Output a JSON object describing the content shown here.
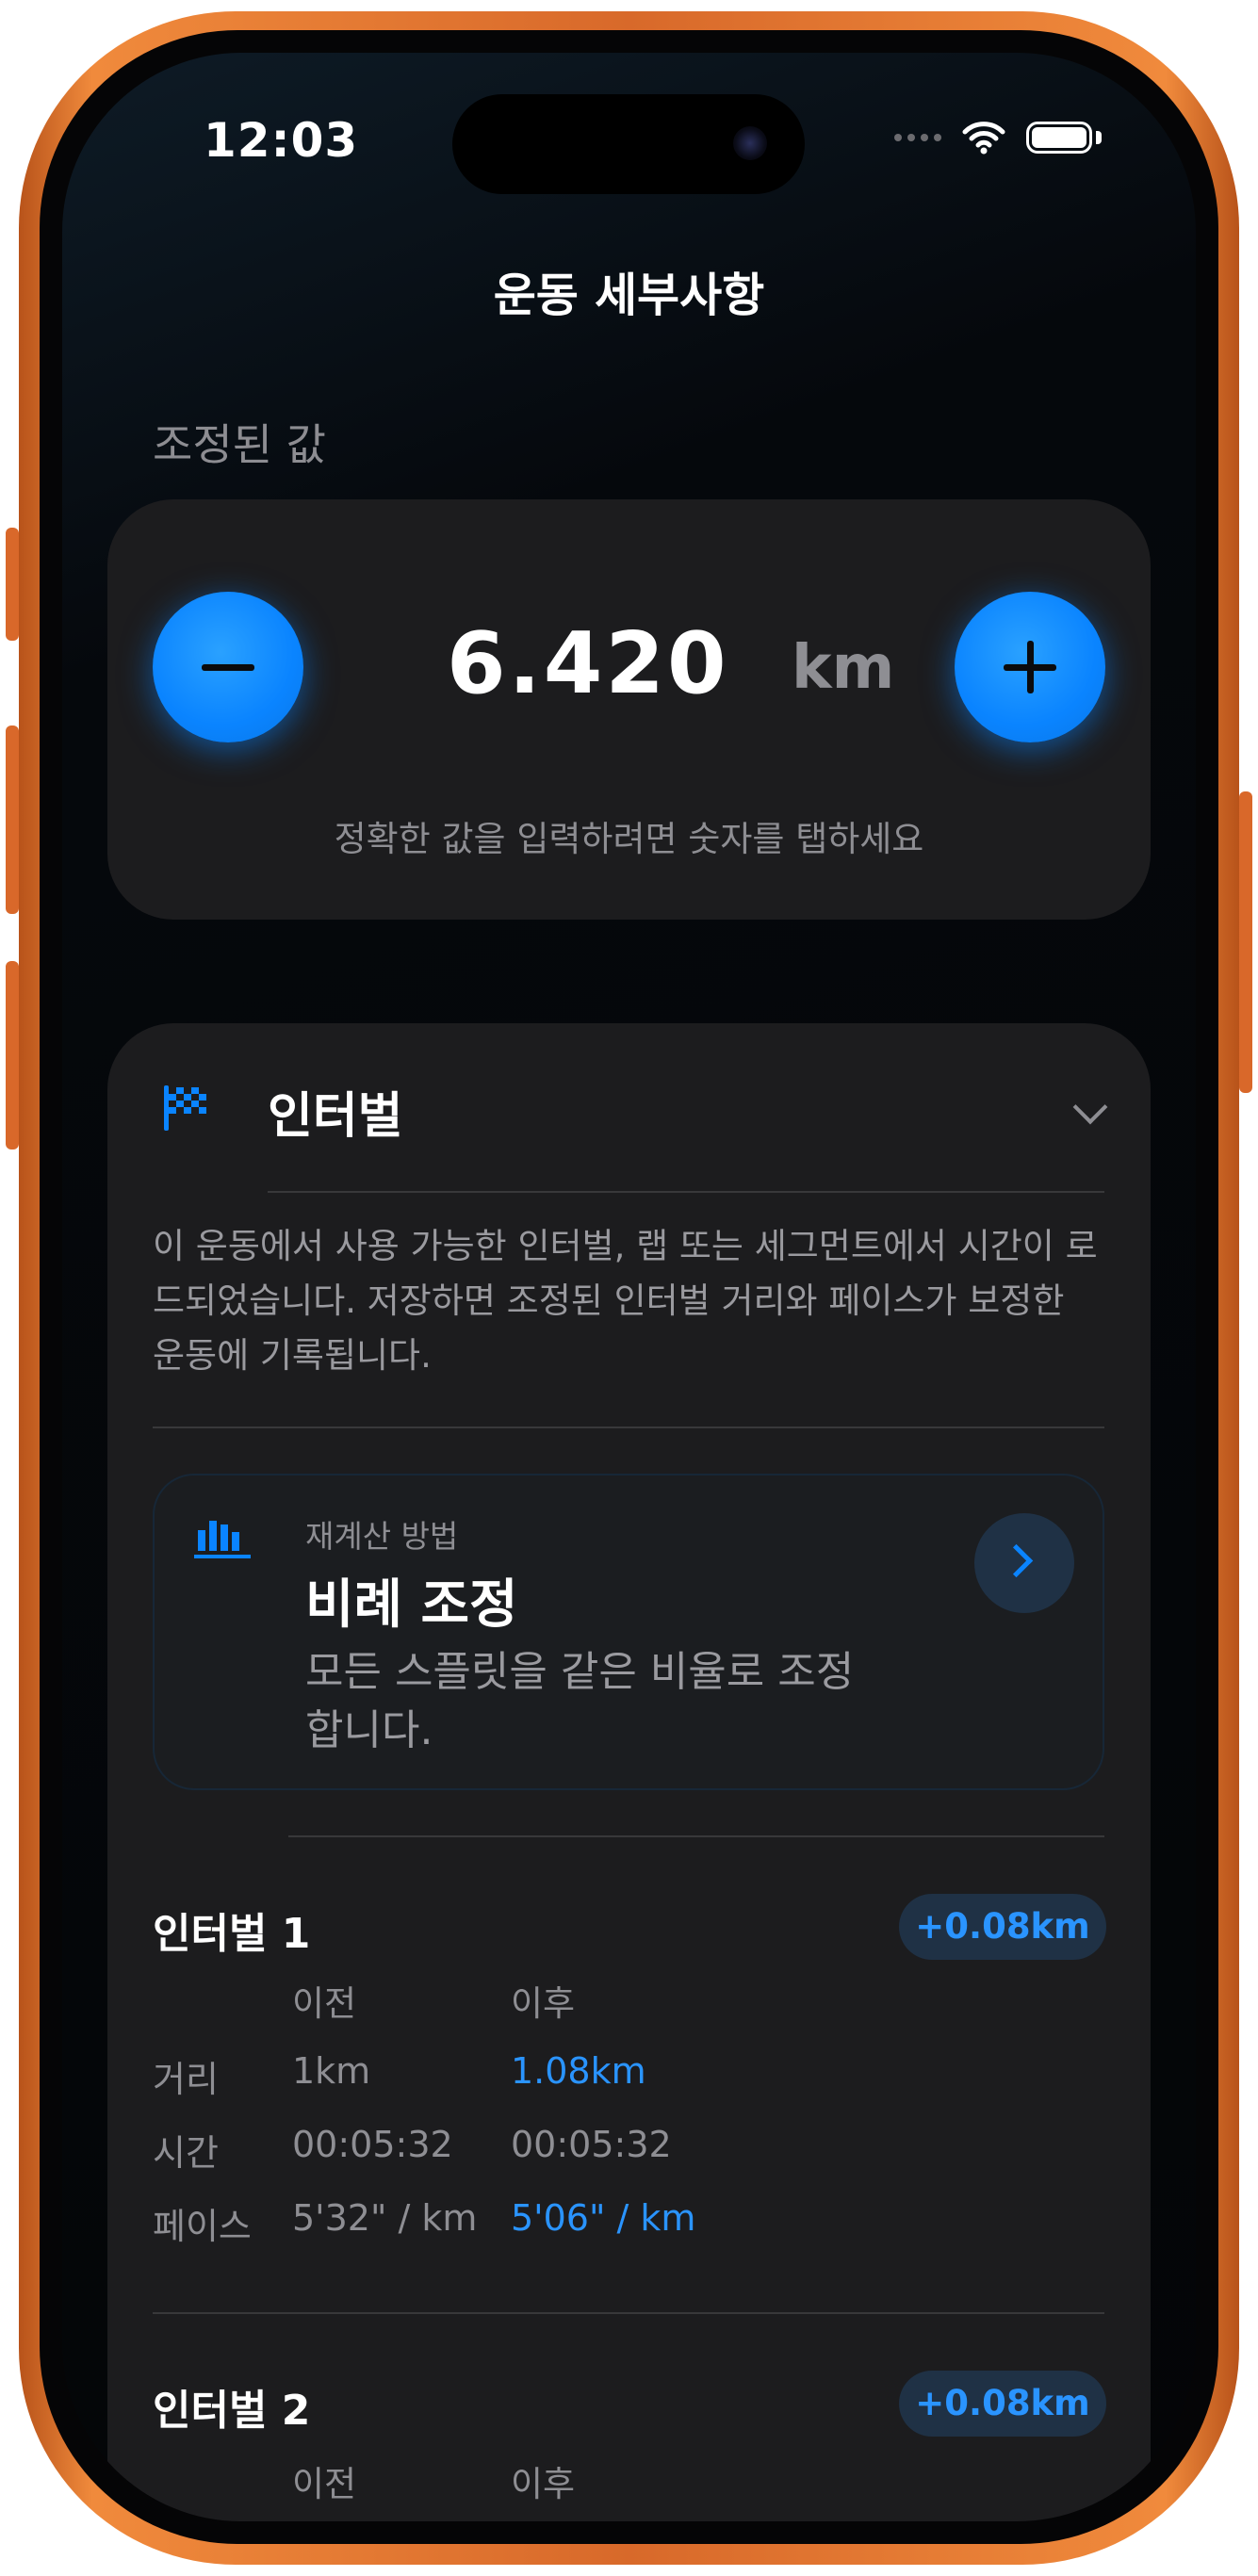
{
  "status_bar": {
    "time": "12:03"
  },
  "nav": {
    "title": "운동 세부사항"
  },
  "adjusted": {
    "section_label": "조정된 값",
    "value": "6.420",
    "unit": "km",
    "hint": "정확한 값을 입력하려면 숫자를 탭하세요",
    "minus_icon": "minus-icon",
    "plus_icon": "plus-icon"
  },
  "intervals_card": {
    "title": "인터벌",
    "icon": "checkered-flag-icon",
    "description": "이 운동에서 사용 가능한 인터벌, 랩 또는 세그먼트에서 시간이 로드되었습니다. 저장하면 조정된 인터벌 거리와 페이스가 보정한 운동에 기록됩니다.",
    "method": {
      "label": "재계산 방법",
      "title": "비례 조정",
      "description": "모든 스플릿을 같은 비율로 조정합니다.",
      "icon": "bar-chart-icon"
    },
    "columns": {
      "before": "이전",
      "after": "이후"
    },
    "row_labels": {
      "distance": "거리",
      "time": "시간",
      "pace": "페이스"
    },
    "items": [
      {
        "title": "인터벌 1",
        "delta": "+0.08km",
        "distance_before": "1km",
        "distance_after": "1.08km",
        "time_before": "00:05:32",
        "time_after": "00:05:32",
        "pace_before": "5'32\" / km",
        "pace_after": "5'06\" / km"
      },
      {
        "title": "인터벌 2",
        "delta": "+0.08km"
      }
    ]
  },
  "colors": {
    "accent": "#0a84ff",
    "frame": "#e87a35",
    "card": "#1c1c1e"
  }
}
